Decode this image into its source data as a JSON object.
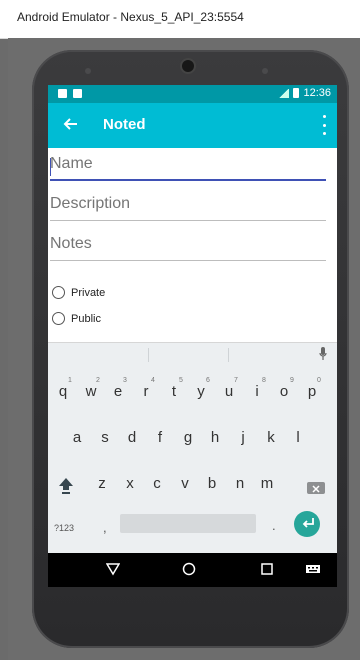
{
  "window": {
    "title": "Android Emulator - Nexus_5_API_23:5554"
  },
  "statusbar": {
    "time": "12:36"
  },
  "appbar": {
    "title": "Noted"
  },
  "form": {
    "name": {
      "placeholder": "Name",
      "value": ""
    },
    "description": {
      "placeholder": "Description",
      "value": ""
    },
    "notes": {
      "placeholder": "Notes",
      "value": ""
    },
    "privacy_options": [
      {
        "label": "Private",
        "selected": false
      },
      {
        "label": "Public",
        "selected": false
      }
    ]
  },
  "keyboard": {
    "row1": [
      "q",
      "w",
      "e",
      "r",
      "t",
      "y",
      "u",
      "i",
      "o",
      "p"
    ],
    "row1_hints": [
      "1",
      "2",
      "3",
      "4",
      "5",
      "6",
      "7",
      "8",
      "9",
      "0"
    ],
    "row2": [
      "a",
      "s",
      "d",
      "f",
      "g",
      "h",
      "j",
      "k",
      "l"
    ],
    "row3": [
      "z",
      "x",
      "c",
      "v",
      "b",
      "n",
      "m"
    ],
    "symbols_label": "?123",
    "comma": ",",
    "period": "."
  },
  "colors": {
    "appbar": "#00bcd4",
    "statusbar": "#0098a6",
    "accent_enter": "#26a69a",
    "field_active_line": "#3f51b5"
  },
  "icons": {
    "back": "arrow-left-icon",
    "overflow": "more-vert-icon",
    "mic": "mic-icon",
    "shift": "shift-icon",
    "backspace": "backspace-icon",
    "enter": "enter-icon",
    "nav_back": "nav-back-icon",
    "nav_home": "nav-home-icon",
    "nav_recents": "nav-recents-icon",
    "nav_keyboard": "keyboard-icon"
  }
}
